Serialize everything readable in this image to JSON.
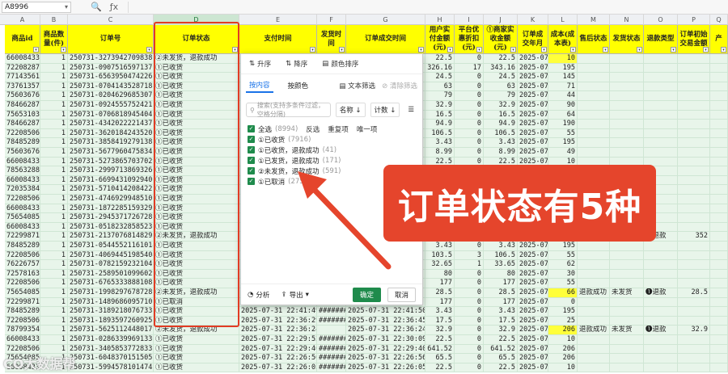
{
  "name_box": "A8996",
  "fb_icons": [
    "🔍",
    "ƒx"
  ],
  "column_letters": [
    "A",
    "B",
    "C",
    "D",
    "E",
    "F",
    "G",
    "H",
    "I",
    "J",
    "K",
    "L",
    "M",
    "N",
    "O",
    "P",
    "Q"
  ],
  "headers": [
    "商品id",
    "商品数量(件)",
    "订单号",
    "订单状态",
    "支付时间",
    "发货时间",
    "订单成交时间",
    "用户实付金额(元)",
    "平台优惠折扣(元)",
    "①商家实收金额(元)",
    "订单成交年月",
    "成本(成本表)",
    "售后状态",
    "发货状态",
    "退款类型",
    "订单初始交易金额",
    "产"
  ],
  "rows": [
    {
      "id": "66008433",
      "qty": "1",
      "order": "250731-327394270983890",
      "status": "②未发货，退款成功",
      "pay": "",
      "ship": "",
      "deal": "",
      "paid": "22.5",
      "disc": "0",
      "net": "22.5",
      "ym": "2025-07",
      "cost": "10",
      "yellow": true
    },
    {
      "id": "72208287",
      "qty": "1",
      "order": "250731-090751659713760",
      "status": "①已收货",
      "pay": "",
      "ship": "",
      "deal": "",
      "paid": "326.16",
      "disc": "17",
      "net": "343.16",
      "ym": "2025-07",
      "cost": "195"
    },
    {
      "id": "77143561",
      "qty": "1",
      "order": "250731-656395047422612",
      "status": "①已收货",
      "pay": "",
      "ship": "",
      "deal": "",
      "paid": "24.5",
      "disc": "0",
      "net": "24.5",
      "ym": "2025-07",
      "cost": "145"
    },
    {
      "id": "73761357",
      "qty": "1",
      "order": "250731-070414352871883",
      "status": "①已收货",
      "pay": "",
      "ship": "",
      "deal": "",
      "paid": "63",
      "disc": "0",
      "net": "63",
      "ym": "2025-07",
      "cost": "71"
    },
    {
      "id": "75603676",
      "qty": "1",
      "order": "250731-020462968530708",
      "status": "①已收货",
      "pay": "",
      "ship": "",
      "deal": "",
      "paid": "79",
      "disc": "0",
      "net": "79",
      "ym": "2025-07",
      "cost": "44"
    },
    {
      "id": "78466287",
      "qty": "1",
      "order": "250731-092455575242174",
      "status": "①已收货",
      "pay": "",
      "ship": "",
      "deal": "",
      "paid": "32.9",
      "disc": "0",
      "net": "32.9",
      "ym": "2025-07",
      "cost": "90"
    },
    {
      "id": "75653103",
      "qty": "1",
      "order": "250731-070681894540476",
      "status": "①已收货",
      "pay": "",
      "ship": "",
      "deal": "",
      "paid": "16.5",
      "disc": "0",
      "net": "16.5",
      "ym": "2025-07",
      "cost": "64"
    },
    {
      "id": "78466287",
      "qty": "1",
      "order": "250731-434202222143720",
      "status": "①已收货",
      "pay": "",
      "ship": "",
      "deal": "",
      "paid": "94.9",
      "disc": "0",
      "net": "94.9",
      "ym": "2025-07",
      "cost": "190"
    },
    {
      "id": "72208506",
      "qty": "1",
      "order": "250731-362018424352012",
      "status": "①已收货",
      "pay": "",
      "ship": "",
      "deal": "",
      "paid": "106.5",
      "disc": "0",
      "net": "106.5",
      "ym": "2025-07",
      "cost": "55"
    },
    {
      "id": "78485289",
      "qty": "1",
      "order": "250731-385841927913824",
      "status": "①已收货",
      "pay": "",
      "ship": "",
      "deal": "",
      "paid": "3.43",
      "disc": "0",
      "net": "3.43",
      "ym": "2025-07",
      "cost": "195"
    },
    {
      "id": "75603676",
      "qty": "1",
      "order": "250731-567796047583452",
      "status": "①已收货",
      "pay": "",
      "ship": "",
      "deal": "",
      "paid": "8.99",
      "disc": "0",
      "net": "8.99",
      "ym": "2025-07",
      "cost": "49"
    },
    {
      "id": "66008433",
      "qty": "1",
      "order": "250731-527386570370294",
      "status": "①已收货",
      "pay": "",
      "ship": "",
      "deal": "",
      "paid": "22.5",
      "disc": "0",
      "net": "22.5",
      "ym": "2025-07",
      "cost": "10"
    },
    {
      "id": "78563288",
      "qty": "1",
      "order": "250731-299971386932664",
      "status": "①已收货",
      "pay": "",
      "ship": "",
      "deal": "",
      "paid": "6.59",
      "disc": "0",
      "net": "6.59",
      "ym": "2025-07",
      "cost": "205"
    },
    {
      "id": "66008433",
      "qty": "1",
      "order": "250731-669943109294009",
      "status": "①已收货",
      "pay": "",
      "ship": "",
      "deal": "",
      "paid": "",
      "disc": "",
      "net": "",
      "ym": "",
      "cost": ""
    },
    {
      "id": "72035384",
      "qty": "1",
      "order": "250731-571041420842225",
      "status": "①已收货",
      "pay": "",
      "ship": "",
      "deal": "",
      "paid": "",
      "disc": "",
      "net": "",
      "ym": "",
      "cost": ""
    },
    {
      "id": "72208506",
      "qty": "1",
      "order": "250731-474692994851070",
      "status": "①已收货",
      "pay": "",
      "ship": "",
      "deal": "",
      "paid": "",
      "disc": "",
      "net": "",
      "ym": "",
      "cost": ""
    },
    {
      "id": "66008433",
      "qty": "1",
      "order": "250731-187228515932934",
      "status": "①已收货",
      "pay": "",
      "ship": "",
      "deal": "",
      "paid": "",
      "disc": "",
      "net": "",
      "ym": "",
      "cost": ""
    },
    {
      "id": "75654085",
      "qty": "1",
      "order": "250731-294537172672896",
      "status": "①已收货",
      "pay": "",
      "ship": "",
      "deal": "",
      "paid": "",
      "disc": "",
      "net": "",
      "ym": "",
      "cost": ""
    },
    {
      "id": "66008433",
      "qty": "1",
      "order": "250731-051823285852364",
      "status": "①已收货",
      "pay": "",
      "ship": "",
      "deal": "",
      "paid": "",
      "disc": "",
      "net": "",
      "ym": "",
      "cost": ""
    },
    {
      "id": "72299871",
      "qty": "1",
      "order": "250731-213707681482956",
      "status": "②未发货，退款成功",
      "pay": "",
      "ship": "",
      "deal": "",
      "paid": "",
      "disc": "",
      "net": "",
      "ym": "",
      "cost": "",
      "yellow": true,
      "after": "",
      "shipst": "",
      "refund": "❶退款",
      "init": "352"
    },
    {
      "id": "78485289",
      "qty": "1",
      "order": "250731-054455211610148",
      "status": "①已收货",
      "pay": "",
      "ship": "",
      "deal": "",
      "paid": "3.43",
      "disc": "0",
      "net": "3.43",
      "ym": "2025-07",
      "cost": "195"
    },
    {
      "id": "72208506",
      "qty": "1",
      "order": "250731-406944519854045",
      "status": "①已收货",
      "pay": "",
      "ship": "",
      "deal": "",
      "paid": "103.5",
      "disc": "3",
      "net": "106.5",
      "ym": "2025-07",
      "cost": "55"
    },
    {
      "id": "76226757",
      "qty": "1",
      "order": "250731-078215923210401",
      "status": "①已收货",
      "pay": "",
      "ship": "",
      "deal": "",
      "paid": "32.65",
      "disc": "1",
      "net": "33.65",
      "ym": "2025-07",
      "cost": "62"
    },
    {
      "id": "72578163",
      "qty": "1",
      "order": "250731-258950109960290",
      "status": "①已收货",
      "pay": "",
      "ship": "",
      "deal": "",
      "paid": "80",
      "disc": "0",
      "net": "80",
      "ym": "2025-07",
      "cost": "30"
    },
    {
      "id": "72208506",
      "qty": "1",
      "order": "250731-676533388810857",
      "status": "①已收货",
      "pay": "",
      "ship": "",
      "deal": "",
      "paid": "177",
      "disc": "0",
      "net": "177",
      "ym": "2025-07",
      "cost": "55"
    },
    {
      "id": "75654085",
      "qty": "1",
      "order": "250731-199829767872896",
      "status": "②未发货，退款成功",
      "pay": "",
      "ship": "",
      "deal": "",
      "paid": "28.5",
      "disc": "0",
      "net": "28.5",
      "ym": "2025-07",
      "cost": "66",
      "yellow": true,
      "after": "退款成功",
      "shipst": "未发货",
      "refund": "❶退款",
      "init": "28.5"
    },
    {
      "id": "72299871",
      "qty": "1",
      "order": "250731-148968609571070",
      "status": "①已取消",
      "pay": "",
      "ship": "",
      "deal": "",
      "paid": "177",
      "disc": "0",
      "net": "177",
      "ym": "2025-07",
      "cost": "0"
    },
    {
      "id": "78485289",
      "qty": "1",
      "order": "250731-318921807673389",
      "status": "①已收货",
      "pay": "2025-07-31 22:41:49",
      "ship": "########",
      "deal": "2025-07-31 22:41:50",
      "paid": "3.43",
      "disc": "0",
      "net": "3.43",
      "ym": "2025-07",
      "cost": "195"
    },
    {
      "id": "72208506",
      "qty": "1",
      "order": "250731-189359726092581",
      "status": "①已收货",
      "pay": "2025-07-31 22:36:29",
      "ship": "########",
      "deal": "2025-07-31 22:36:45",
      "paid": "17.5",
      "disc": "0",
      "net": "17.5",
      "ym": "2025-07",
      "cost": "25"
    },
    {
      "id": "78799354",
      "qty": "1",
      "order": "250731-562511244801791",
      "status": "②未发货，退款成功",
      "pay": "2025-07-31 22:36:24",
      "ship": "",
      "deal": "2025-07-31 22:36:24",
      "paid": "32.9",
      "disc": "0",
      "net": "32.9",
      "ym": "2025-07",
      "cost": "206",
      "yellow": true,
      "after": "退款成功",
      "shipst": "未发货",
      "refund": "❶退款",
      "init": "32.9"
    },
    {
      "id": "66008433",
      "qty": "1",
      "order": "250731-028633996913361",
      "status": "①已收货",
      "pay": "2025-07-31 22:29:52",
      "ship": "########",
      "deal": "2025-07-31 22:30:09",
      "paid": "22.5",
      "disc": "0",
      "net": "22.5",
      "ym": "2025-07",
      "cost": "10"
    },
    {
      "id": "72208506",
      "qty": "1",
      "order": "250731-340585377283353",
      "status": "①已收货",
      "pay": "2025-07-31 22:29:40",
      "ship": "########",
      "deal": "2025-07-31 22:29:40",
      "paid": "641.52",
      "disc": "0",
      "net": "641.52",
      "ym": "2025-07",
      "cost": "206"
    },
    {
      "id": "75654085",
      "qty": "1",
      "order": "250731-604837015150573",
      "status": "①已收货",
      "pay": "2025-07-31 22:26:56",
      "ship": "########",
      "deal": "2025-07-31 22:26:56",
      "paid": "65.5",
      "disc": "0",
      "net": "65.5",
      "ym": "2025-07",
      "cost": "206"
    },
    {
      "id": "66008433",
      "qty": "1",
      "order": "250731-599457810147481",
      "status": "①已收货",
      "pay": "2025-07-31 22:26:05",
      "ship": "########",
      "deal": "2025-07-31 22:26:05",
      "paid": "22.5",
      "disc": "0",
      "net": "22.5",
      "ym": "2025-07",
      "cost": "10"
    }
  ],
  "popup": {
    "sort_asc": "升序",
    "sort_desc": "降序",
    "sort_color": "颜色排序",
    "tab_content": "按内容",
    "tab_color": "按颜色",
    "text_filter": "文本筛选",
    "clear_filter": "清除筛选",
    "search_placeholder": "搜索(支持多条件过滤，空格分隔)",
    "name_btn": "名称",
    "count_btn": "计数",
    "select_all": "全选",
    "select_all_count": "(8994)",
    "invert": "反选",
    "repeat": "重复项",
    "unique": "唯一项",
    "options": [
      {
        "label": "①已收货",
        "count": "(7916)"
      },
      {
        "label": "①已收货，退款成功",
        "count": "(41)"
      },
      {
        "label": "①已发货，退款成功",
        "count": "(171)"
      },
      {
        "label": "②未发货，退款成功",
        "count": "(591)"
      },
      {
        "label": "①已取消",
        "count": "(275)"
      }
    ],
    "analyze": "分析",
    "export": "导出",
    "ok": "确定",
    "cancel": "取消"
  },
  "annotation": {
    "banner_text": "订单状态有5种"
  },
  "watermark": "CO大数据帮",
  "colors": {
    "header_yellow": "#ffff00",
    "row_green": "#e8f5ea",
    "accent_red": "#e5452c",
    "ok_green": "#1f8b4c"
  }
}
